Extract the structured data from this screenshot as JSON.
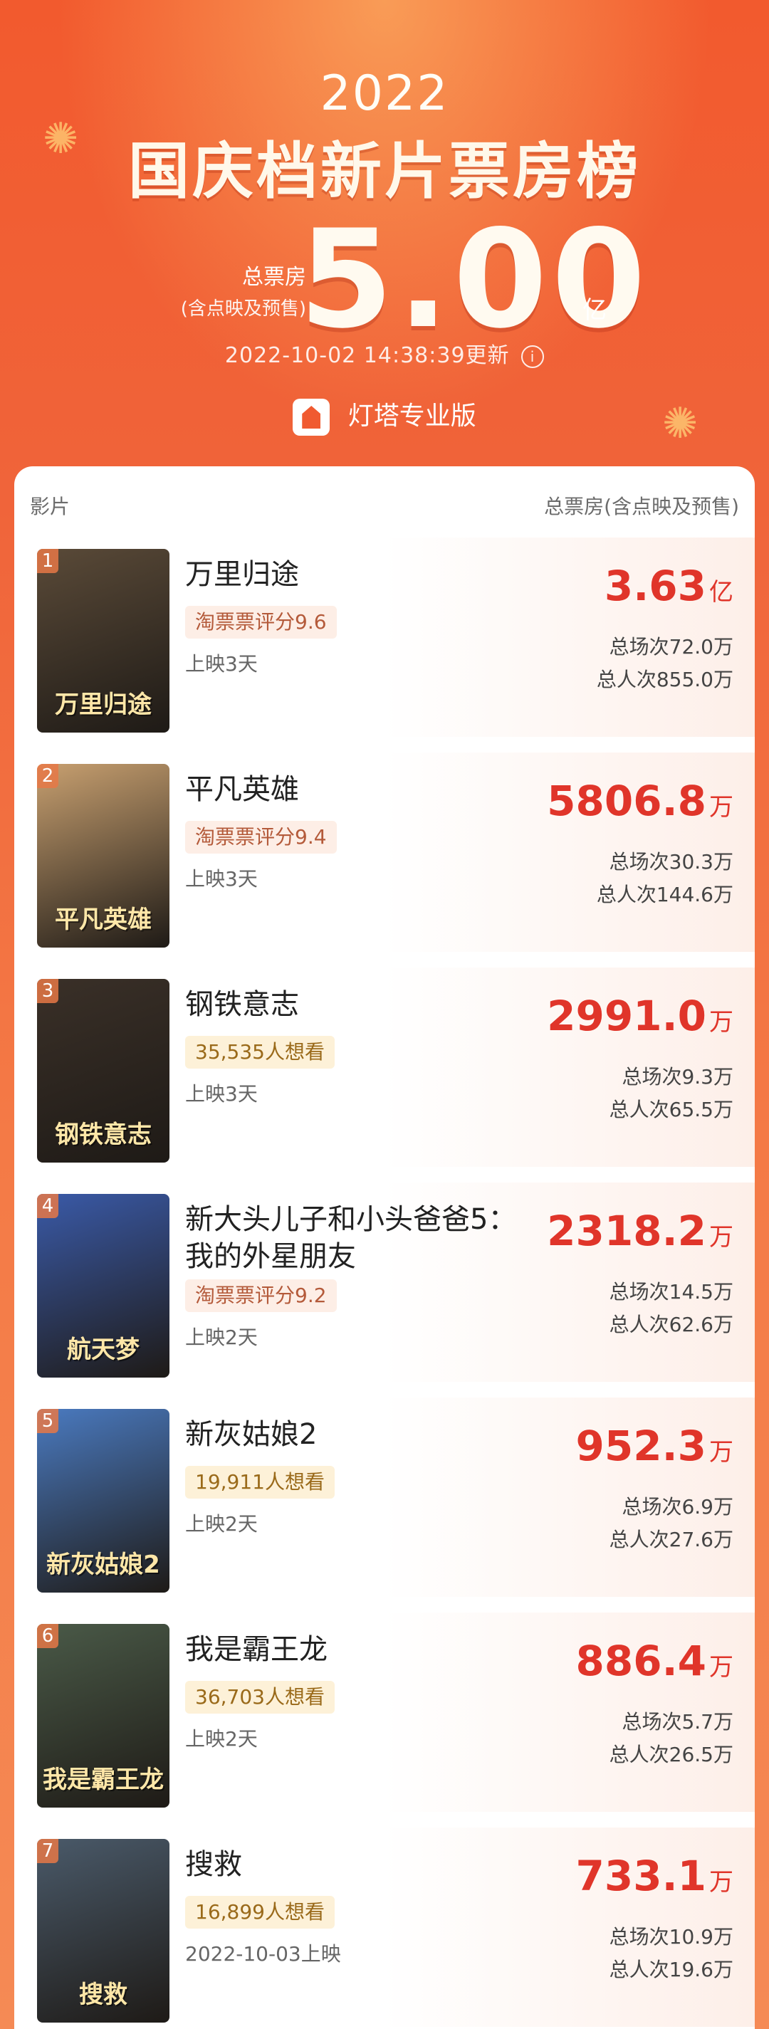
{
  "header": {
    "year": "2022",
    "title": "国庆档新片票房榜",
    "total_label": "总票房",
    "total_sub": "(含点映及预售)",
    "total_value": "5.00",
    "total_unit": "亿",
    "update_time": "2022-10-02 14:38:39更新",
    "info_icon": "i",
    "brand": "灯塔专业版"
  },
  "table": {
    "col_left": "影片",
    "col_right": "总票房(含点映及预售)"
  },
  "movies": [
    {
      "rank": "1",
      "poster_text": "万里归途",
      "title": "万里归途",
      "badge": "淘票票评分9.6",
      "release": "上映3天",
      "box": "3.63",
      "unit": "亿",
      "sessions": "总场次72.0万",
      "viewers": "总人次855.0万"
    },
    {
      "rank": "2",
      "poster_text": "平凡英雄",
      "title": "平凡英雄",
      "badge": "淘票票评分9.4",
      "release": "上映3天",
      "box": "5806.8",
      "unit": "万",
      "sessions": "总场次30.3万",
      "viewers": "总人次144.6万"
    },
    {
      "rank": "3",
      "poster_text": "钢铁意志",
      "title": "钢铁意志",
      "badge": "35,535人想看",
      "release": "上映3天",
      "box": "2991.0",
      "unit": "万",
      "sessions": "总场次9.3万",
      "viewers": "总人次65.5万"
    },
    {
      "rank": "4",
      "poster_text": "航天梦",
      "title": "新大头儿子和小头爸爸5：我的外星朋友",
      "badge": "淘票票评分9.2",
      "release": "上映2天",
      "box": "2318.2",
      "unit": "万",
      "sessions": "总场次14.5万",
      "viewers": "总人次62.6万"
    },
    {
      "rank": "5",
      "poster_text": "新灰姑娘2",
      "title": "新灰姑娘2",
      "badge": "19,911人想看",
      "release": "上映2天",
      "box": "952.3",
      "unit": "万",
      "sessions": "总场次6.9万",
      "viewers": "总人次27.6万"
    },
    {
      "rank": "6",
      "poster_text": "我是霸王龙",
      "title": "我是霸王龙",
      "badge": "36,703人想看",
      "release": "上映2天",
      "box": "886.4",
      "unit": "万",
      "sessions": "总场次5.7万",
      "viewers": "总人次26.5万"
    },
    {
      "rank": "7",
      "poster_text": "搜救",
      "title": "搜救",
      "badge": "16,899人想看",
      "release": "2022-10-03上映",
      "box": "733.1",
      "unit": "万",
      "sessions": "总场次10.9万",
      "viewers": "总人次19.6万"
    }
  ],
  "poster_colors": [
    "#5a4a38",
    "#c8a070",
    "#3a3028",
    "#3a5aa8",
    "#4a7ac0",
    "#4a5a48",
    "#4a5a6a"
  ]
}
